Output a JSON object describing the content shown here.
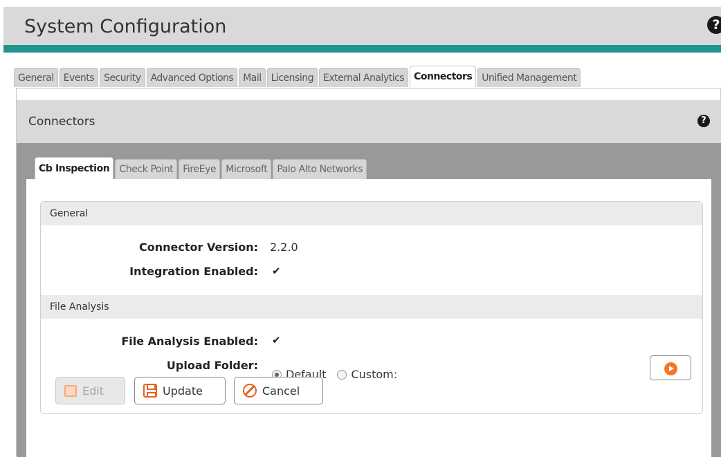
{
  "header": {
    "title": "System Configuration",
    "help_icon": "help-icon"
  },
  "top_tabs": [
    {
      "label": "General"
    },
    {
      "label": "Events"
    },
    {
      "label": "Security"
    },
    {
      "label": "Advanced Options"
    },
    {
      "label": "Mail"
    },
    {
      "label": "Licensing"
    },
    {
      "label": "External Analytics"
    },
    {
      "label": "Connectors",
      "active": true
    },
    {
      "label": "Unified Management"
    }
  ],
  "section": {
    "title": "Connectors",
    "help_icon": "help-icon"
  },
  "sub_tabs": [
    {
      "label": "Cb Inspection",
      "active": true
    },
    {
      "label": "Check Point"
    },
    {
      "label": "FireEye"
    },
    {
      "label": "Microsoft"
    },
    {
      "label": "Palo Alto Networks"
    }
  ],
  "general": {
    "header": "General",
    "connector_version_label": "Connector Version:",
    "connector_version_value": "2.2.0",
    "integration_enabled_label": "Integration Enabled:",
    "integration_enabled_checked": true
  },
  "file_analysis": {
    "header": "File Analysis",
    "enabled_label": "File Analysis Enabled:",
    "enabled_checked": true,
    "upload_folder_label": "Upload Folder:",
    "radio_default": "Default",
    "radio_custom": "Custom:",
    "selected": "Default"
  },
  "buttons": {
    "edit": "Edit",
    "update": "Update",
    "cancel": "Cancel"
  },
  "colors": {
    "accent_teal": "#1d968f",
    "icon_orange": "#e8621a"
  }
}
